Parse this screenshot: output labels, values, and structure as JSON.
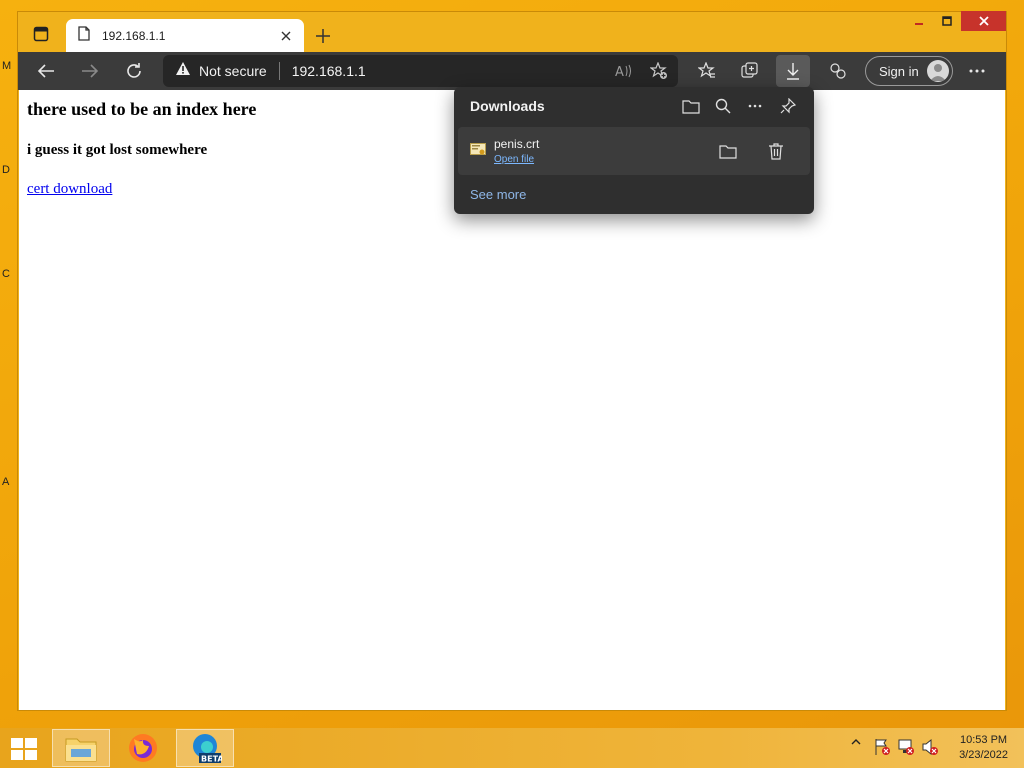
{
  "desktop": {
    "fragments": [
      "M",
      "D",
      "C",
      "A"
    ]
  },
  "browser": {
    "tab_title": "192.168.1.1",
    "address": {
      "security_label": "Not secure",
      "url": "192.168.1.1"
    },
    "sign_in_label": "Sign in"
  },
  "page": {
    "heading": "there used to be an index here",
    "subheading": "i guess it got lost somewhere",
    "link_text": "cert download"
  },
  "downloads": {
    "title": "Downloads",
    "items": [
      {
        "file_name": "penis.crt",
        "action_label": "Open file"
      }
    ],
    "see_more_label": "See more"
  },
  "taskbar": {
    "apps": [
      "File Explorer",
      "Firefox",
      "Edge Beta"
    ],
    "edge_badge": "BETA",
    "clock": {
      "time": "10:53 PM",
      "date": "3/23/2022"
    }
  },
  "colors": {
    "window_frame": "#f0b21c",
    "toolbar": "#3b3b3b",
    "close_button": "#c7332b",
    "link": "#0000ee",
    "flyout": "#2f2f2f"
  }
}
